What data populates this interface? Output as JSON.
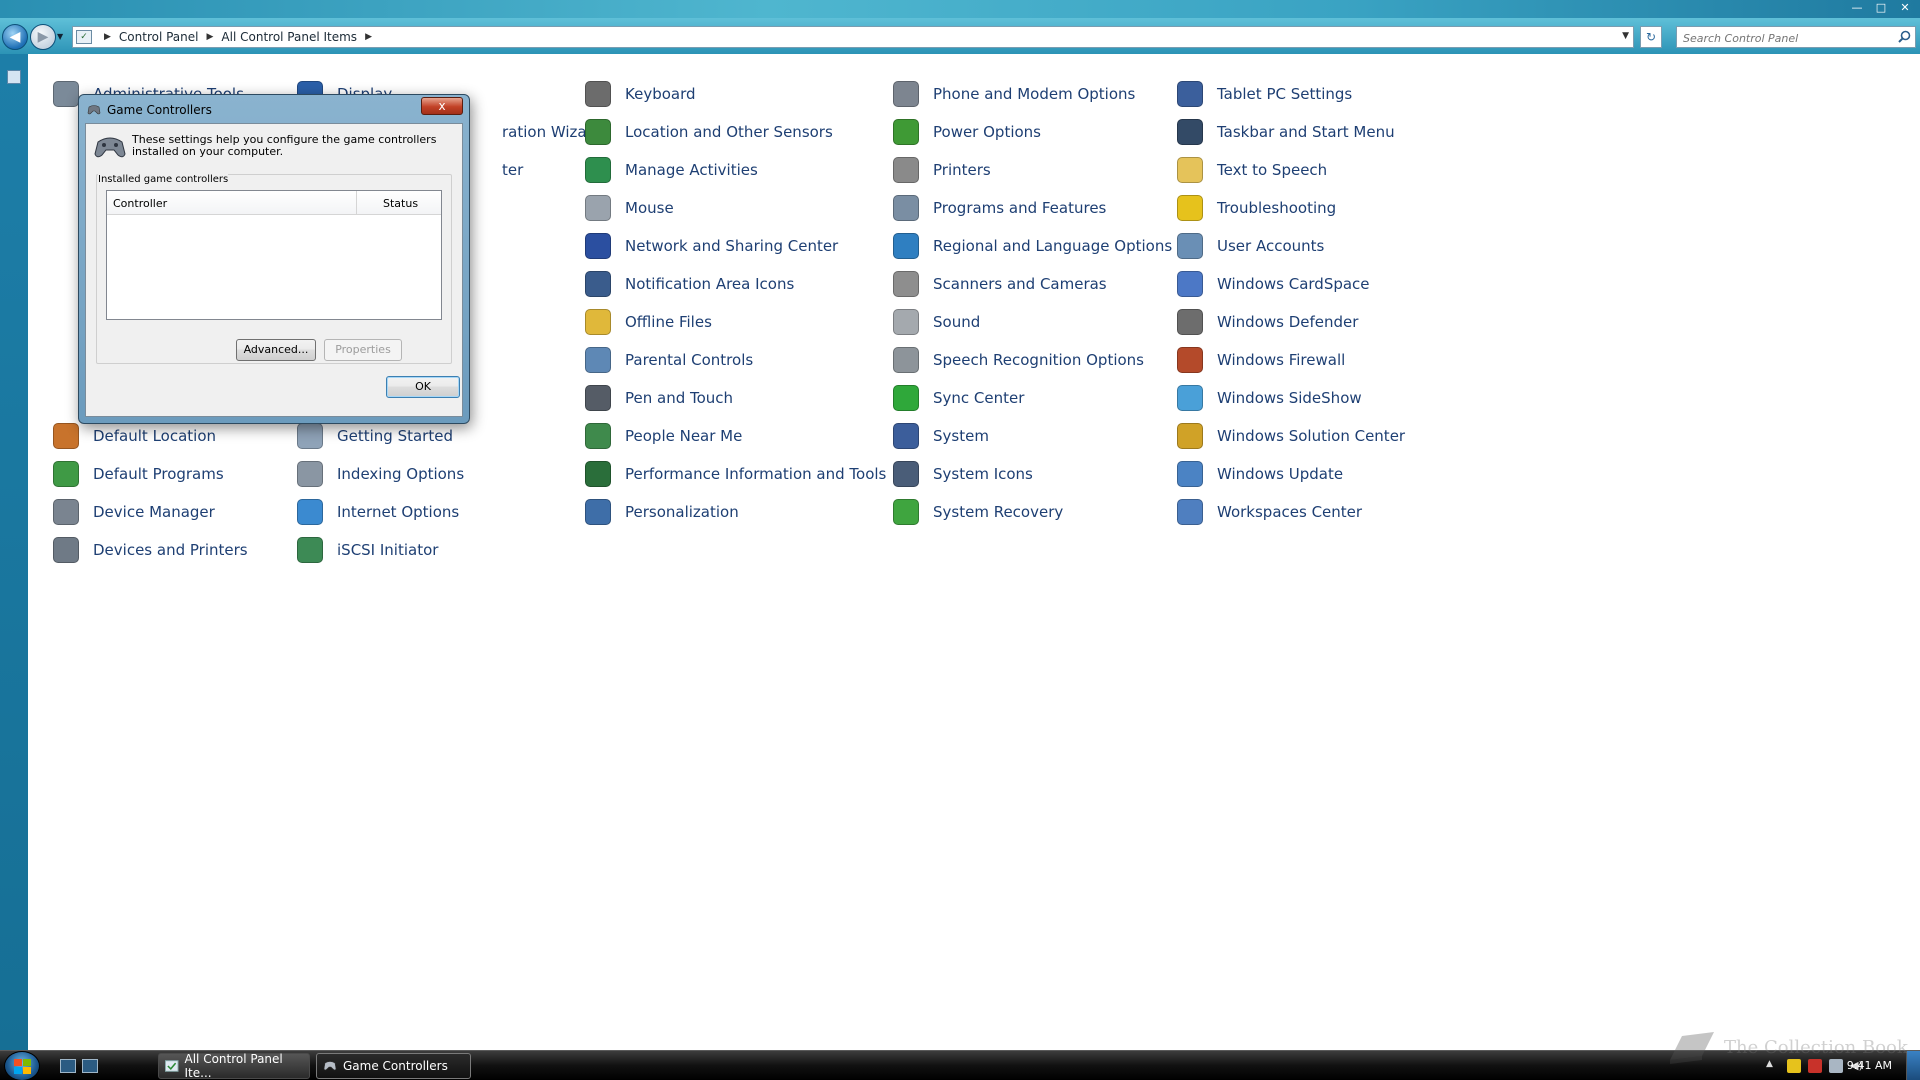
{
  "address_bar": {
    "crumbs": [
      "Control Panel",
      "All Control Panel Items"
    ],
    "search_placeholder": "Search Control Panel"
  },
  "window_controls": {
    "minimize": "—",
    "maximize": "□",
    "close": "✕"
  },
  "control_panel": {
    "items": [
      {
        "label": "Administrative Tools",
        "icon": "admin-tools-icon",
        "color": "#7b8a99"
      },
      {
        "label": "Display",
        "icon": "display-icon",
        "color": "#2a5fa8"
      },
      {
        "label": "Keyboard",
        "icon": "keyboard-icon",
        "color": "#6c6c6c"
      },
      {
        "label": "Phone and Modem Options",
        "icon": "phone-modem-icon",
        "color": "#7d8590"
      },
      {
        "label": "Tablet PC Settings",
        "icon": "tablet-pc-icon",
        "color": "#3b5f9c"
      },
      {
        "label": "ration Wizard",
        "icon": "",
        "color": ""
      },
      {
        "label": "Location and Other Sensors",
        "icon": "location-sensors-icon",
        "color": "#3d8a3d"
      },
      {
        "label": "Power Options",
        "icon": "power-options-icon",
        "color": "#3f9a35"
      },
      {
        "label": "Taskbar and Start Menu",
        "icon": "taskbar-icon",
        "color": "#334a66"
      },
      {
        "label": "ter",
        "icon": "",
        "color": ""
      },
      {
        "label": "Manage Activities",
        "icon": "manage-activities-icon",
        "color": "#2e8f4e"
      },
      {
        "label": "Printers",
        "icon": "printers-icon",
        "color": "#8a8a8a"
      },
      {
        "label": "Text to Speech",
        "icon": "text-to-speech-icon",
        "color": "#e5c35a"
      },
      {
        "label": "Mouse",
        "icon": "mouse-icon",
        "color": "#9aa3ad"
      },
      {
        "label": "Programs and Features",
        "icon": "programs-features-icon",
        "color": "#7a8ea3"
      },
      {
        "label": "Troubleshooting",
        "icon": "troubleshooting-icon",
        "color": "#e6c21c"
      },
      {
        "label": "Network and Sharing Center",
        "icon": "network-sharing-icon",
        "color": "#2b4fa0"
      },
      {
        "label": "Regional and Language Options",
        "icon": "regional-language-icon",
        "color": "#2f7fc1"
      },
      {
        "label": "User Accounts",
        "icon": "user-accounts-icon",
        "color": "#6a8fb5"
      },
      {
        "label": "Notification Area Icons",
        "icon": "notification-area-icon",
        "color": "#3a5c8c"
      },
      {
        "label": "Scanners and Cameras",
        "icon": "scanners-cameras-icon",
        "color": "#8e8e8e"
      },
      {
        "label": "Windows CardSpace",
        "icon": "cardspace-icon",
        "color": "#4c78c6"
      },
      {
        "label": "Offline Files",
        "icon": "offline-files-icon",
        "color": "#e0b83a"
      },
      {
        "label": "Sound",
        "icon": "sound-icon",
        "color": "#a4a9ae"
      },
      {
        "label": "Windows Defender",
        "icon": "defender-icon",
        "color": "#6d6d6d"
      },
      {
        "label": "Parental Controls",
        "icon": "parental-controls-icon",
        "color": "#5e88b5"
      },
      {
        "label": "Speech Recognition Options",
        "icon": "speech-recognition-icon",
        "color": "#8d949a"
      },
      {
        "label": "Windows Firewall",
        "icon": "firewall-icon",
        "color": "#b44a2a"
      },
      {
        "label": "Pen and Touch",
        "icon": "pen-touch-icon",
        "color": "#555c66"
      },
      {
        "label": "Sync Center",
        "icon": "sync-center-icon",
        "color": "#2fa83a"
      },
      {
        "label": "Windows SideShow",
        "icon": "sideshow-icon",
        "color": "#4aa0d8"
      },
      {
        "label": "People Near Me",
        "icon": "people-near-me-icon",
        "color": "#3f8a4c"
      },
      {
        "label": "System",
        "icon": "system-icon",
        "color": "#3c5e9b"
      },
      {
        "label": "Windows Solution Center",
        "icon": "solution-center-icon",
        "color": "#d0a227"
      },
      {
        "label": "Performance Information and Tools",
        "icon": "performance-icon",
        "color": "#2a6e3a"
      },
      {
        "label": "System Icons",
        "icon": "system-icons-icon",
        "color": "#4a5d78"
      },
      {
        "label": "Windows Update",
        "icon": "windows-update-icon",
        "color": "#4b83c4"
      },
      {
        "label": "Personalization",
        "icon": "personalization-icon",
        "color": "#3e6ea8"
      },
      {
        "label": "System Recovery",
        "icon": "system-recovery-icon",
        "color": "#3fa53f"
      },
      {
        "label": "Workspaces Center",
        "icon": "workspaces-center-icon",
        "color": "#4f7fc0"
      },
      {
        "label": "Default Location",
        "icon": "default-location-icon",
        "color": "#c8732c"
      },
      {
        "label": "Getting Started",
        "icon": "getting-started-icon",
        "color": "#8fa3b8"
      },
      {
        "label": "Default Programs",
        "icon": "default-programs-icon",
        "color": "#3f9a45"
      },
      {
        "label": "Indexing Options",
        "icon": "indexing-options-icon",
        "color": "#8a96a3"
      },
      {
        "label": "Device Manager",
        "icon": "device-manager-icon",
        "color": "#7a8490"
      },
      {
        "label": "Internet Options",
        "icon": "internet-options-icon",
        "color": "#3b8ad0"
      },
      {
        "label": "Devices and Printers",
        "icon": "devices-printers-icon",
        "color": "#6f7a86"
      },
      {
        "label": "iSCSI Initiator",
        "icon": "iscsi-initiator-icon",
        "color": "#3d8a55"
      }
    ]
  },
  "dialog": {
    "title": "Game Controllers",
    "close_label": "x",
    "intro": "These settings help you configure the game controllers installed on your computer.",
    "group_label": "Installed game controllers",
    "columns": [
      "Controller",
      "Status"
    ],
    "buttons": {
      "advanced": "Advanced...",
      "properties": "Properties",
      "ok": "OK"
    }
  },
  "taskbar": {
    "buttons": [
      "All Control Panel Ite...",
      "Game Controllers"
    ],
    "clock": "9:41 AM"
  },
  "watermark": "The Collection Book"
}
